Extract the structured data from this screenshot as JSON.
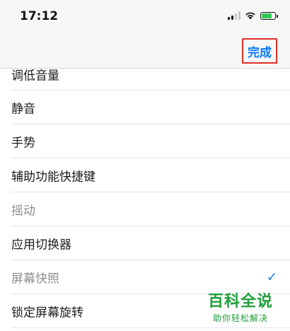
{
  "status_bar": {
    "time": "17:12",
    "signal": {
      "bars": 4,
      "active": 2
    },
    "wifi_icon": "wifi-icon",
    "battery": {
      "level": 0.85,
      "charging": true,
      "color": "#34c759"
    }
  },
  "nav": {
    "done_label": "完成",
    "done_color": "#0a7aff"
  },
  "list": {
    "items": [
      {
        "label": "调低音量",
        "enabled": true,
        "checked": false
      },
      {
        "label": "静音",
        "enabled": true,
        "checked": false
      },
      {
        "label": "手势",
        "enabled": true,
        "checked": false
      },
      {
        "label": "辅助功能快捷键",
        "enabled": true,
        "checked": false
      },
      {
        "label": "摇动",
        "enabled": false,
        "checked": false
      },
      {
        "label": "应用切换器",
        "enabled": true,
        "checked": false
      },
      {
        "label": "屏幕快照",
        "enabled": false,
        "checked": true
      },
      {
        "label": "锁定屏幕旋转",
        "enabled": true,
        "checked": false
      }
    ]
  },
  "watermark": {
    "title": "百科全说",
    "subtitle": "助你轻松解决"
  }
}
